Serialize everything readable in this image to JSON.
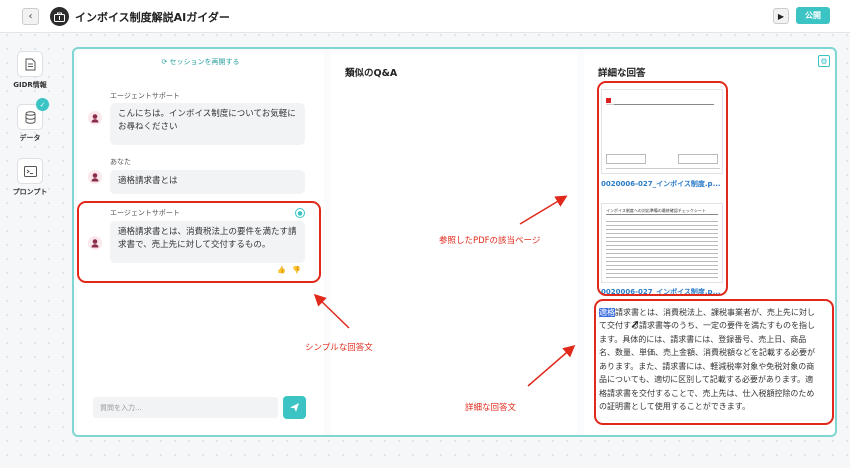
{
  "header": {
    "title": "インボイス制度解説AIガイダー",
    "back_icon": "chevron-left-icon",
    "play_icon": "play-icon",
    "publish_label": "公開"
  },
  "sidebar": {
    "items": [
      {
        "label": "GIDR情報",
        "icon": "document-icon"
      },
      {
        "label": "データ",
        "icon": "database-icon",
        "checked": true
      },
      {
        "label": "プロンプト",
        "icon": "terminal-icon"
      }
    ]
  },
  "chat": {
    "restart_label": "セッションを再開する",
    "messages": [
      {
        "sender": "エージェントサポート",
        "text": "こんにちは。インボイス制度についてお気軽にお尋ねください"
      },
      {
        "sender": "あなた",
        "text": "適格請求書とは"
      },
      {
        "sender": "エージェントサポート",
        "text": "適格請求書とは、消費税法上の要件を満たす請求書で、売上先に対して交付するもの。"
      }
    ],
    "input_placeholder": "質問を入力..."
  },
  "similar": {
    "title": "類似のQ&A"
  },
  "detail": {
    "title": "詳細な回答",
    "pdfs": [
      {
        "name": "0020006-027_インボイス制度.p..."
      },
      {
        "name": "0020006-027_インボイス制度.p..."
      }
    ],
    "pdf2_header": "インボイス制度への対応準備の最終確認チェックシート",
    "answer_highlight": "適格",
    "answer_rest": "請求書とは、消費税法上、課税事業者が、売上先に対して交付する請求書等のうち、一定の要件を満たすものを指します。具体的には、請求書には、登録番号、売上日、商品名、数量、単価、売上金額、消費税額などを記載する必要があります。また、請求書には、軽減税率対象や免税対象の商品についても、適切に区別して記載する必要があります。適格請求書を交付することで、売上先は、仕入税額控除のための証明書として使用することができます。"
  },
  "annotations": {
    "simple_answer": "シンプルな回答文",
    "pdf_page": "参照したPDFの該当ページ",
    "detailed_answer": "詳細な回答文"
  },
  "colors": {
    "accent": "#3cc4c4",
    "annotation": "#e0291b",
    "link": "#2a7cc7"
  }
}
